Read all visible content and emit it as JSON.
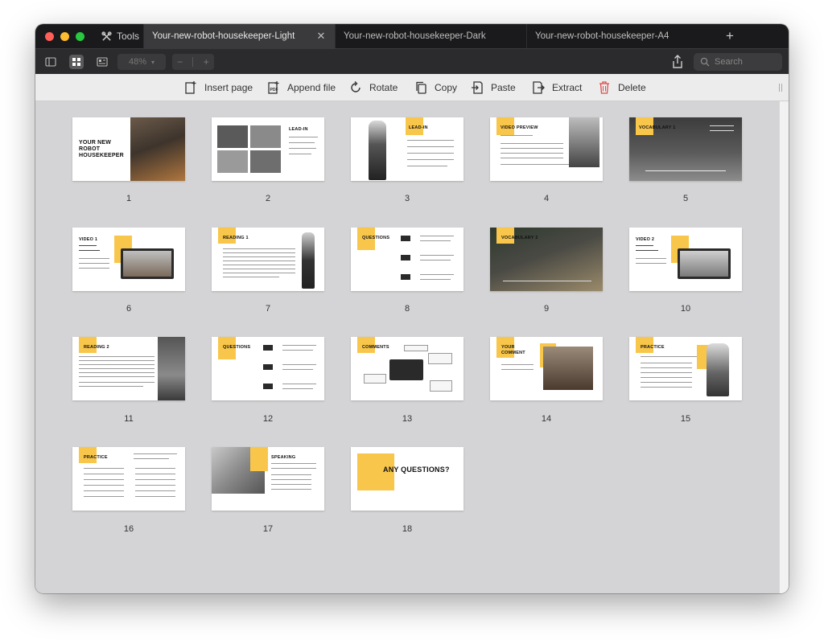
{
  "tabbar": {
    "tools_label": "Tools",
    "tabs": [
      {
        "label": "Your-new-robot-housekeeper-Light",
        "active": true
      },
      {
        "label": "Your-new-robot-housekeeper-Dark",
        "active": false
      },
      {
        "label": "Your-new-robot-housekeeper-A4",
        "active": false
      }
    ],
    "close_glyph": "✕",
    "new_tab_glyph": "+"
  },
  "viewbar": {
    "zoom_value": "48%",
    "zoom_minus": "−",
    "zoom_plus": "+",
    "search_placeholder": "Search"
  },
  "toolbar": {
    "insert_page": "Insert page",
    "append_file": "Append file",
    "rotate": "Rotate",
    "copy": "Copy",
    "paste": "Paste",
    "extract": "Extract",
    "delete": "Delete"
  },
  "pages": [
    {
      "number": "1",
      "title": "YOUR NEW ROBOT HOUSEKEEPER"
    },
    {
      "number": "2",
      "title": "LEAD-IN"
    },
    {
      "number": "3",
      "title": "LEAD-IN"
    },
    {
      "number": "4",
      "title": "VIDEO PREVIEW"
    },
    {
      "number": "5",
      "title": "VOCABULARY 1"
    },
    {
      "number": "6",
      "title": "VIDEO 1"
    },
    {
      "number": "7",
      "title": "READING 1"
    },
    {
      "number": "8",
      "title": "QUESTIONS"
    },
    {
      "number": "9",
      "title": "VOCABULARY 2"
    },
    {
      "number": "10",
      "title": "VIDEO 2"
    },
    {
      "number": "11",
      "title": "READING 2"
    },
    {
      "number": "12",
      "title": "QUESTIONS"
    },
    {
      "number": "13",
      "title": "COMMENTS"
    },
    {
      "number": "14",
      "title": "YOUR COMMENT"
    },
    {
      "number": "15",
      "title": "PRACTICE"
    },
    {
      "number": "16",
      "title": "PRACTICE"
    },
    {
      "number": "17",
      "title": "SPEAKING"
    },
    {
      "number": "18",
      "title": "ANY QUESTIONS?"
    }
  ],
  "colors": {
    "accent_yellow": "#f8c64a",
    "tabbar_bg": "#1a1a1c",
    "content_bg": "#d4d4d6",
    "delete_red": "#e04b4b"
  }
}
